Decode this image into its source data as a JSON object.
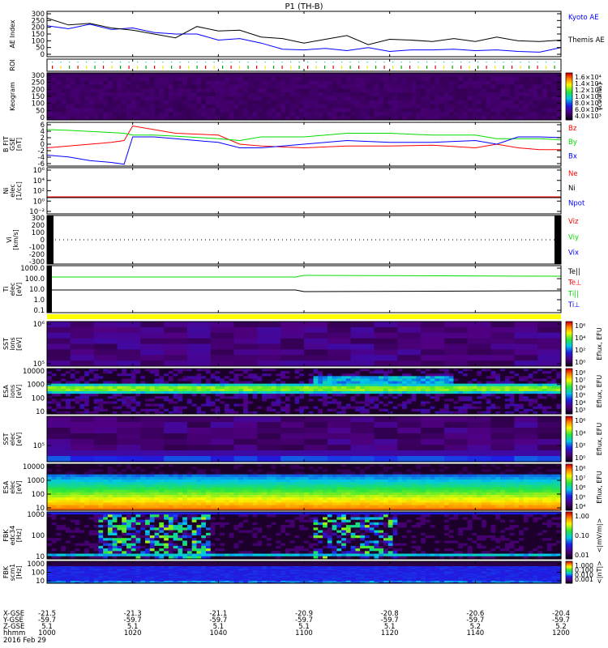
{
  "title": "P1 (TH-B)",
  "chart_data": {
    "type": "line",
    "title": "P1 (TH-B)",
    "time_range": [
      "1000",
      "1200"
    ],
    "panels": [
      {
        "id": "ae",
        "ylabel": [
          "AE Index"
        ],
        "yticks": [
          "300",
          "250",
          "200",
          "150",
          "100",
          "50",
          "0"
        ],
        "ylim": [
          0,
          300
        ],
        "legend": [
          {
            "name": "Kyoto AE",
            "color": "#0000ff"
          },
          {
            "name": "Themis AE",
            "color": "#000000"
          }
        ],
        "series": [
          {
            "name": "Kyoto AE",
            "color": "#0000ff",
            "t": [
              0,
              5,
              10,
              15,
              20,
              25,
              30,
              35,
              40,
              45,
              50,
              55,
              60,
              65,
              70,
              75,
              80,
              85,
              90,
              95,
              100,
              105,
              110,
              115,
              120
            ],
            "y": [
              205,
              185,
              215,
              180,
              190,
              160,
              150,
              150,
              110,
              120,
              90,
              50,
              45,
              55,
              40,
              60,
              35,
              45,
              45,
              50,
              40,
              45,
              35,
              30,
              60
            ]
          },
          {
            "name": "Themis AE",
            "color": "#000000",
            "t": [
              0,
              5,
              10,
              15,
              20,
              25,
              30,
              35,
              40,
              45,
              50,
              55,
              60,
              65,
              70,
              75,
              80,
              85,
              90,
              95,
              100,
              105,
              110,
              115,
              120
            ],
            "y": [
              255,
              210,
              220,
              190,
              175,
              150,
              125,
              200,
              170,
              175,
              130,
              120,
              90,
              115,
              140,
              80,
              115,
              110,
              100,
              120,
              100,
              130,
              105,
              100,
              110
            ]
          }
        ]
      },
      {
        "id": "roi",
        "ylabel": [
          "ROI"
        ],
        "yticks": []
      },
      {
        "id": "keogram",
        "ylabel": [
          "Keogram"
        ],
        "yticks": [
          "300",
          "250",
          "200",
          "150",
          "100",
          "50",
          "0"
        ],
        "colorbar": {
          "label": "[counts]",
          "ticks": [
            "1.6×10⁴",
            "1.4×10⁴",
            "1.2×10⁴",
            "1.0×10⁴",
            "8.0×10³",
            "6.0×10³",
            "4.0×10³"
          ]
        }
      },
      {
        "id": "bfit",
        "ylabel": [
          "B FIT",
          "GSE",
          "[nT]"
        ],
        "yticks": [
          "6",
          "4",
          "2",
          "0",
          "-2",
          "-4",
          "-6"
        ],
        "ylim": [
          -6,
          6
        ],
        "legend": [
          {
            "name": "Bz",
            "color": "#ff0000"
          },
          {
            "name": "By",
            "color": "#00dd00"
          },
          {
            "name": "Bx",
            "color": "#0000ff"
          }
        ],
        "series": [
          {
            "name": "Bz",
            "color": "#ff0000",
            "t": [
              0,
              5,
              10,
              15,
              18,
              20,
              25,
              30,
              40,
              45,
              50,
              60,
              70,
              80,
              90,
              100,
              105,
              110,
              115,
              120
            ],
            "y": [
              -1,
              -0.5,
              0,
              0.5,
              1,
              5,
              4,
              3,
              2.5,
              0,
              -0.5,
              -1,
              -0.5,
              -0.5,
              -0.3,
              -1,
              0,
              -1,
              -1.5,
              -1.5
            ]
          },
          {
            "name": "By",
            "color": "#00dd00",
            "t": [
              0,
              5,
              10,
              15,
              18,
              20,
              25,
              30,
              40,
              45,
              50,
              60,
              70,
              80,
              90,
              100,
              105,
              110,
              115,
              120
            ],
            "y": [
              4,
              3.8,
              3.5,
              3.2,
              3,
              2.5,
              2.5,
              2.2,
              1.5,
              1,
              2,
              2,
              3,
              3,
              2.5,
              2.5,
              1.5,
              1.5,
              1.5,
              1.2
            ]
          },
          {
            "name": "Bx",
            "color": "#0000ff",
            "t": [
              0,
              5,
              10,
              15,
              18,
              20,
              25,
              30,
              40,
              45,
              50,
              60,
              70,
              80,
              90,
              100,
              105,
              110,
              115,
              120
            ],
            "y": [
              -3,
              -3.5,
              -4.5,
              -5,
              -5.5,
              2,
              2,
              1.5,
              0.5,
              -1,
              -1,
              0,
              1,
              0.5,
              0.5,
              1,
              0,
              2,
              2,
              1.8
            ]
          }
        ]
      },
      {
        "id": "ni",
        "ylabel": [
          "Ni",
          "elec",
          "[1/cc]"
        ],
        "yticks": [
          "10⁶",
          "10⁴",
          "10²",
          "10⁰",
          "10⁻²"
        ],
        "legend": [
          {
            "name": "Ne",
            "color": "#ff0000"
          },
          {
            "name": "Ni",
            "color": "#000000"
          },
          {
            "name": "Npot",
            "color": "#0000ff"
          }
        ]
      },
      {
        "id": "vi",
        "ylabel": [
          "Vi",
          "[km/s]"
        ],
        "yticks": [
          "300",
          "200",
          "100",
          "0",
          "-100",
          "-200",
          "-300"
        ],
        "legend": [
          {
            "name": "Viz",
            "color": "#ff0000"
          },
          {
            "name": "Viy",
            "color": "#00dd00"
          },
          {
            "name": "Vix",
            "color": "#0000ff"
          }
        ]
      },
      {
        "id": "ti",
        "ylabel": [
          "Ti",
          "elec",
          "[eV]"
        ],
        "yticks": [
          "1000.0",
          "100.0",
          "10.0",
          "1.0",
          "0.1"
        ],
        "legend": [
          {
            "name": "Te||",
            "color": "#000000"
          },
          {
            "name": "Te⊥",
            "color": "#ff0000"
          },
          {
            "name": "Ti||",
            "color": "#00dd00"
          },
          {
            "name": "Ti⊥",
            "color": "#0000ff"
          }
        ]
      },
      {
        "id": "sst_i",
        "ylabel": [
          "SST",
          "ions",
          "[eV]"
        ],
        "yticks": [
          "10⁶",
          "10⁵"
        ],
        "colorbar": {
          "label": "Eflux, EFU",
          "ticks": [
            "10⁶",
            "10⁴",
            "10²",
            "10⁰"
          ]
        }
      },
      {
        "id": "esa_i",
        "ylabel": [
          "ESA",
          "ions",
          "[eV]"
        ],
        "yticks": [
          "10000",
          "1000",
          "100",
          "10"
        ],
        "colorbar": {
          "label": "Eflux, EFU",
          "ticks": [
            "10⁸",
            "10⁷",
            "10⁶",
            "10⁵",
            "10⁴",
            "10³"
          ]
        }
      },
      {
        "id": "sst_e",
        "ylabel": [
          "SST",
          "elec",
          "[eV]"
        ],
        "yticks": [
          "10⁵"
        ],
        "colorbar": {
          "label": "Eflux, EFU",
          "ticks": [
            "10⁶",
            "10⁴",
            "10²",
            "10⁰"
          ]
        }
      },
      {
        "id": "esa_e",
        "ylabel": [
          "ESA",
          "elec",
          "[eV]"
        ],
        "yticks": [
          "10000",
          "1000",
          "100",
          "10"
        ],
        "colorbar": {
          "label": "Eflux, EFU",
          "ticks": [
            "10⁸",
            "10⁷",
            "10⁶",
            "10⁵",
            "10⁴"
          ]
        }
      },
      {
        "id": "fbk_e",
        "ylabel": [
          "FBK",
          "edc34",
          "[Hz]"
        ],
        "yticks": [
          "1000",
          "100",
          "10"
        ],
        "colorbar": {
          "label": "<|mV/m|>",
          "ticks": [
            "1.00",
            "0.10",
            "0.01"
          ]
        }
      },
      {
        "id": "fbk_b",
        "ylabel": [
          "FBK",
          "scm1",
          "[Hz]"
        ],
        "yticks": [
          "1000",
          "100",
          "10"
        ],
        "colorbar": {
          "label": "<|nT|>",
          "ticks": [
            "1.000",
            "0.100",
            "0.010",
            "0.001"
          ]
        }
      }
    ],
    "xaxis": {
      "row_labels": [
        "X-GSE",
        "Y-GSE",
        "Z-GSE",
        "hhmm"
      ],
      "ticks": [
        {
          "x": "-21.5",
          "y": "-59.7",
          "z": "5.1",
          "hhmm": "1000"
        },
        {
          "x": "-21.3",
          "y": "-59.7",
          "z": "5.1",
          "hhmm": "1020"
        },
        {
          "x": "-21.1",
          "y": "-59.7",
          "z": "5.1",
          "hhmm": "1040"
        },
        {
          "x": "-20.9",
          "y": "-59.7",
          "z": "5.1",
          "hhmm": "1100"
        },
        {
          "x": "-20.8",
          "y": "-59.7",
          "z": "5.1",
          "hhmm": "1120"
        },
        {
          "x": "-20.6",
          "y": "-59.7",
          "z": "5.2",
          "hhmm": "1140"
        },
        {
          "x": "-20.4",
          "y": "-59.7",
          "z": "5.2",
          "hhmm": "1200"
        }
      ],
      "date": "2016 Feb 29"
    }
  }
}
